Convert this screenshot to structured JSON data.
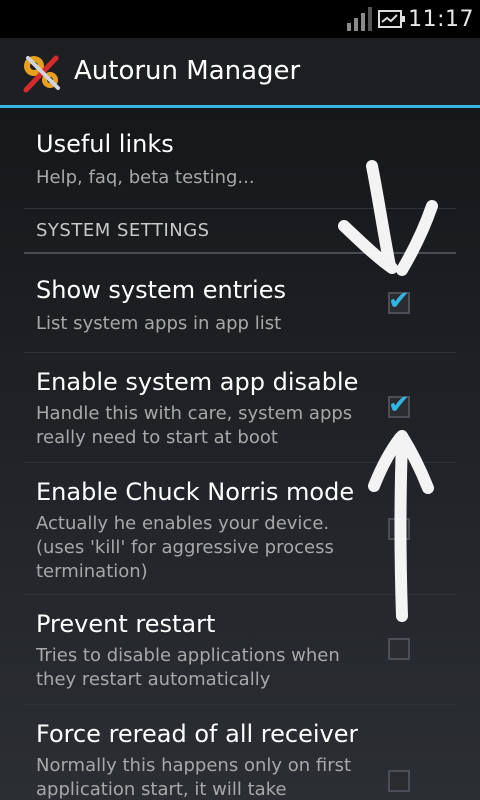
{
  "status_bar": {
    "time": "11:17"
  },
  "app": {
    "title": "Autorun Manager"
  },
  "prefs": {
    "useful_links": {
      "title": "Useful links",
      "summary": "Help, faq, beta testing..."
    },
    "section_header": "SYSTEM SETTINGS",
    "items": [
      {
        "title": "Show system entries",
        "summary": "List system apps in app list",
        "checked": true
      },
      {
        "title": "Enable system app disable",
        "summary": "Handle this with care, system apps really need to start at boot",
        "checked": true
      },
      {
        "title": "Enable Chuck Norris mode",
        "summary": "Actually he enables your device. (uses 'kill' for aggressive process termination)",
        "checked": false
      },
      {
        "title": "Prevent restart",
        "summary": "Tries to disable applications when they restart automatically",
        "checked": false
      },
      {
        "title": "Force reread of all receiver",
        "summary": "Normally this happens only on first application start, it will take",
        "checked": false
      }
    ]
  }
}
